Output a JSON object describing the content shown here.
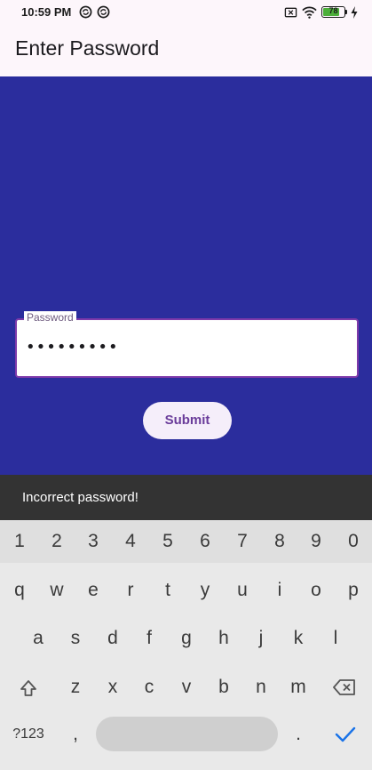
{
  "status_bar": {
    "time": "10:59 PM",
    "battery_level": "78",
    "battery_fraction": 0.78,
    "icons": [
      "sync-icon",
      "sync-icon",
      "close-box-icon",
      "wifi-icon",
      "battery-icon",
      "charging-icon"
    ]
  },
  "app_bar": {
    "title": "Enter Password"
  },
  "form": {
    "password_label": "Password",
    "password_value": "•••••••••",
    "submit_label": "Submit"
  },
  "snackbar": {
    "message": "Incorrect password!"
  },
  "keyboard": {
    "number_row": [
      "1",
      "2",
      "3",
      "4",
      "5",
      "6",
      "7",
      "8",
      "9",
      "0"
    ],
    "row1": [
      "q",
      "w",
      "e",
      "r",
      "t",
      "y",
      "u",
      "i",
      "o",
      "p"
    ],
    "row2": [
      "a",
      "s",
      "d",
      "f",
      "g",
      "h",
      "j",
      "k",
      "l"
    ],
    "row3": [
      "z",
      "x",
      "c",
      "v",
      "b",
      "n",
      "m"
    ],
    "symbols_label": "?123",
    "comma_label": ",",
    "period_label": "."
  },
  "colors": {
    "content_background": "#2b2d9d",
    "field_border": "#7e3aaa",
    "submit_text": "#6a3c9a",
    "snackbar_background": "#333333",
    "enter_key": "#1a73e8"
  }
}
